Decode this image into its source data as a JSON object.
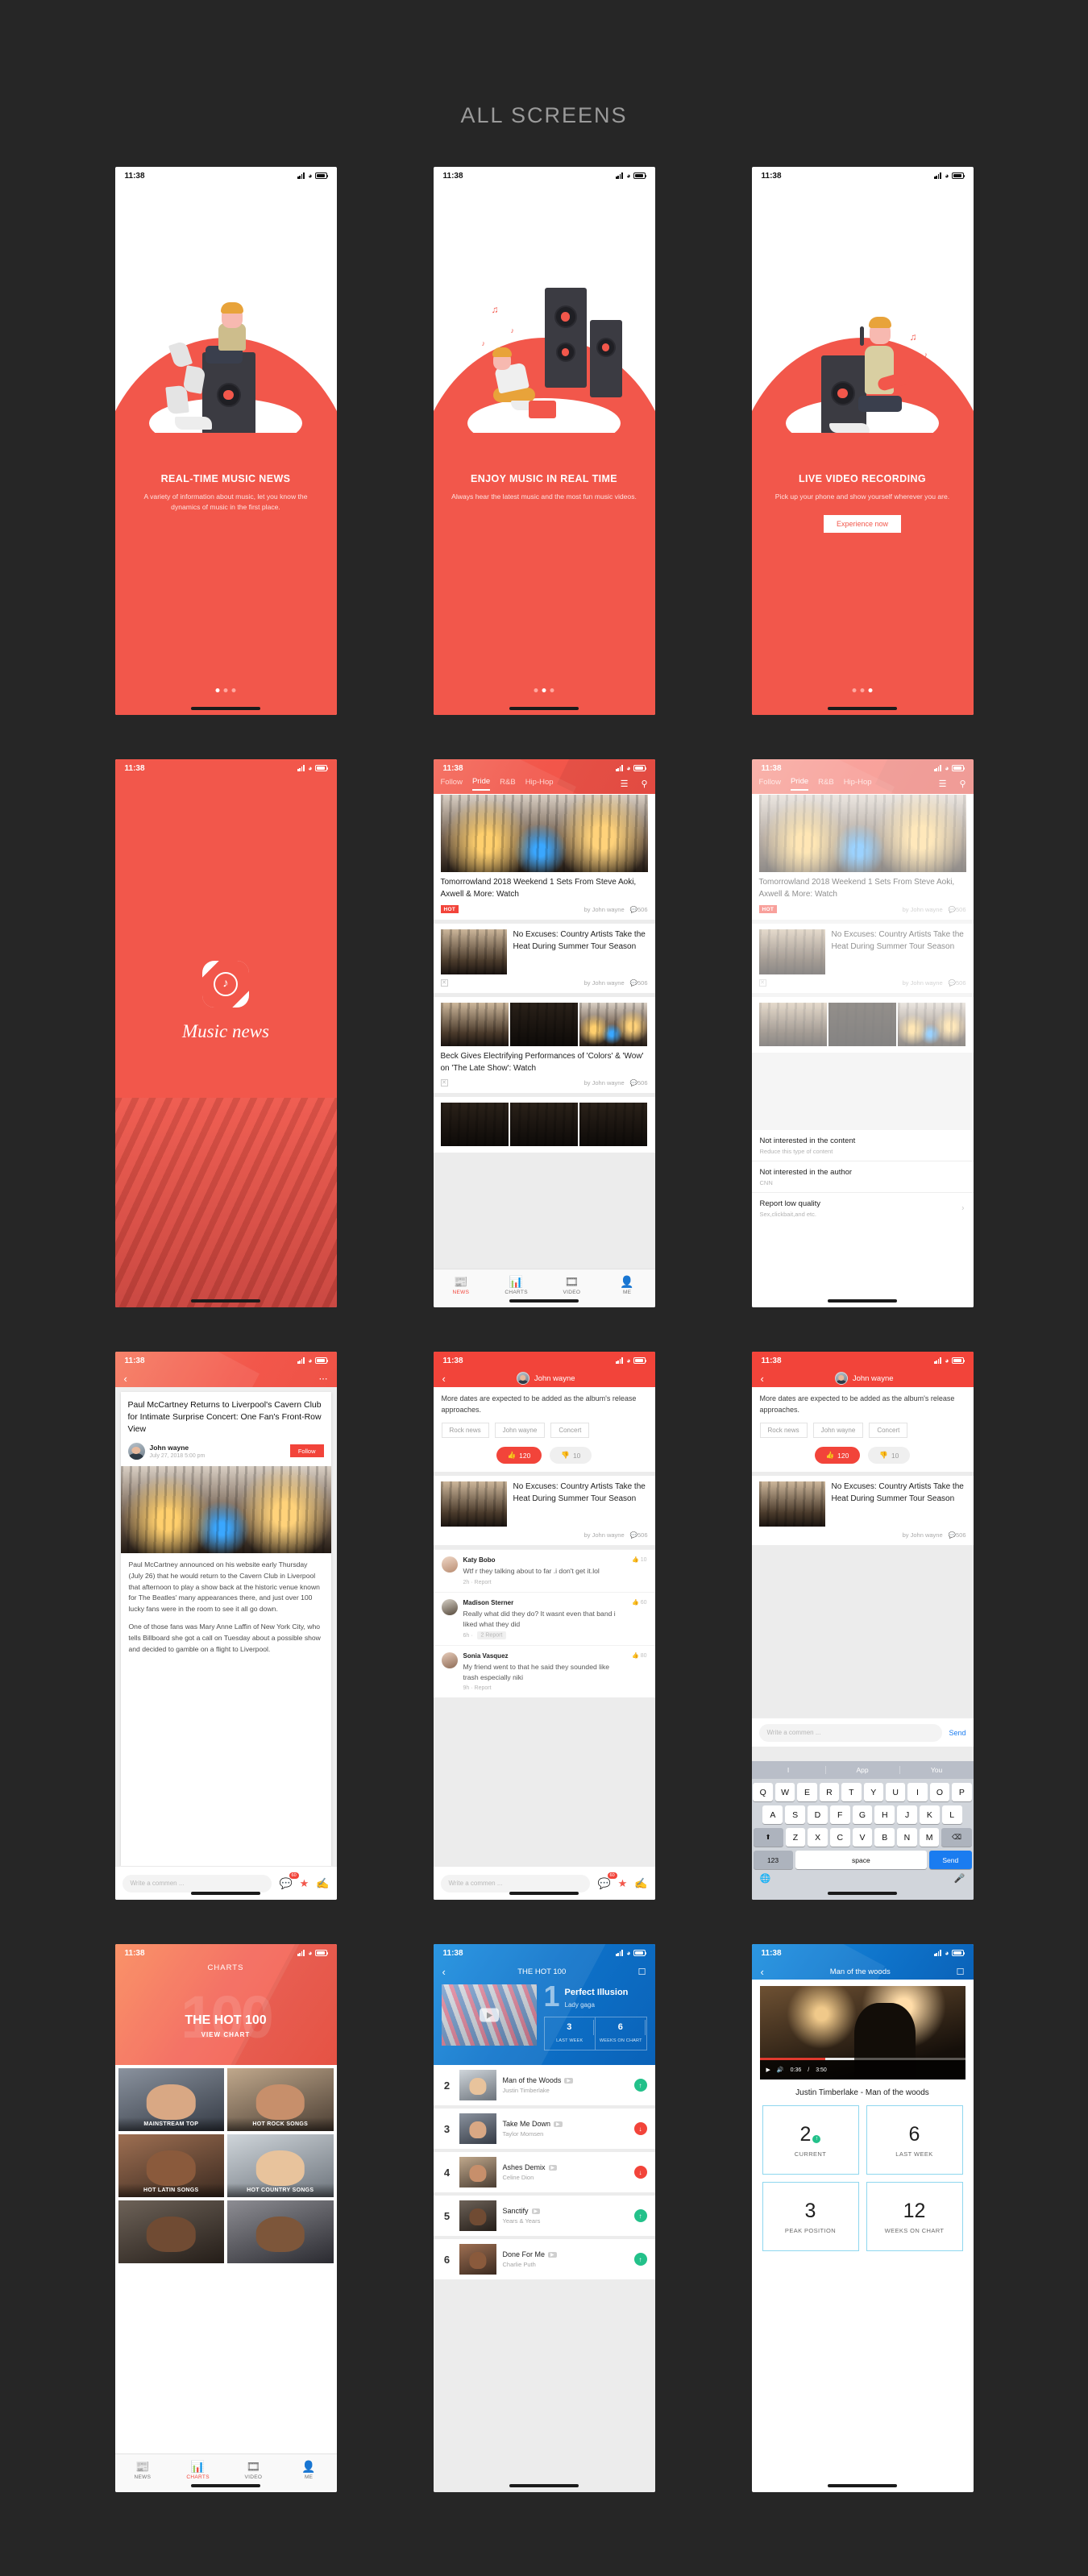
{
  "page": {
    "title": "ALL SCREENS",
    "background": "#262626",
    "accent": "#f2574b",
    "blue": "#0e72c9"
  },
  "status_bar": {
    "time": "11:38",
    "signal_icon": "signal-bars-icon",
    "wifi_icon": "wifi-icon",
    "battery_icon": "battery-icon"
  },
  "onboarding": [
    {
      "title": "REAL-TIME MUSIC NEWS",
      "desc": "A variety of information about music, let you know the dynamics of music in the first place.",
      "active_dot": 0,
      "dots": 3,
      "button": null
    },
    {
      "title": "ENJOY MUSIC IN REAL TIME",
      "desc": "Always hear the latest music and the most fun music videos.",
      "active_dot": 1,
      "dots": 3,
      "button": null
    },
    {
      "title": "LIVE VIDEO RECORDING",
      "desc": "Pick up your phone and show yourself wherever you are.",
      "active_dot": 2,
      "dots": 3,
      "button": "Experience now"
    }
  ],
  "splash": {
    "app_name": "Music news",
    "logo_icon": "music-disc-logo-icon"
  },
  "feed": {
    "tabs": [
      {
        "label": "Follow",
        "active": false
      },
      {
        "label": "Pride",
        "active": true
      },
      {
        "label": "R&B",
        "active": false
      },
      {
        "label": "Hip-Hop",
        "active": false
      }
    ],
    "menu_icon": "hamburger-menu-icon",
    "search_icon": "search-icon",
    "articles": [
      {
        "title": "Tomorrowland 2018 Weekend 1 Sets From Steve Aoki, Axwell & More: Watch",
        "badge": "HOT",
        "author": "by John wayne",
        "comments": "506",
        "layout": "hero"
      },
      {
        "title": "No Excuses: Country Artists Take the Heat During Summer Tour Season",
        "badge": null,
        "author": "by John wayne",
        "comments": "506",
        "layout": "left-thumb"
      },
      {
        "title": "Beck Gives Electrifying Performances of 'Colors' & 'Wow' on 'The Late Show': Watch",
        "badge": null,
        "author": "by John wayne",
        "comments": "506",
        "layout": "three-up"
      }
    ],
    "tabbar": [
      {
        "label": "NEWS",
        "icon": "news-icon",
        "active": true
      },
      {
        "label": "CHARTS",
        "icon": "bar-chart-icon",
        "active": false
      },
      {
        "label": "VIDEO",
        "icon": "film-icon",
        "active": false
      },
      {
        "label": "ME",
        "icon": "person-icon",
        "active": false
      }
    ]
  },
  "action_sheet": [
    {
      "title": "Not interested in the content",
      "sub": "Reduce this type of content",
      "chevron": false
    },
    {
      "title": "Not interested in the author",
      "sub": "CNN",
      "chevron": false
    },
    {
      "title": "Report low quality",
      "sub": "Sex,clickbait,and etc.",
      "chevron": true
    }
  ],
  "article": {
    "back_icon": "chevron-left-icon",
    "more_icon": "more-dots-icon",
    "title": "Paul McCartney Returns to Liverpool's Cavern Club for Intimate Surprise Concert: One Fan's Front-Row View",
    "author": "John wayne",
    "date": "July 27, 2018 5:00 pm",
    "follow_label": "Follow",
    "paragraphs": [
      "Paul McCartney announced on his website early Thursday (July 26) that he would return to the Cavern Club in Liverpool that afternoon to play a show back at the historic venue known for The Beatles' many appearances there, and just over 100 lucky fans were in the room to see it all go down.",
      "One of those fans was Mary Anne Laffin of New York City, who tells Billboard she got a call on Tuesday about a possible show and decided to gamble on a flight to Liverpool."
    ],
    "comment_placeholder": "Write a commen ...",
    "comment_count": "60",
    "icons": {
      "comment": "comment-bubble-icon",
      "star": "star-icon",
      "share": "share-icon"
    }
  },
  "comments_screen": {
    "back_icon": "chevron-left-icon",
    "header_name": "John wayne",
    "intro": "More dates are expected to be added as the album's release approaches.",
    "tags": [
      "Rock news",
      "John wayne",
      "Concert"
    ],
    "likes": "120",
    "dislikes": "10",
    "like_icon": "thumbs-up-icon",
    "dislike_icon": "thumbs-down-icon",
    "related": {
      "title": "No Excuses: Country Artists Take the Heat During Summer Tour Season",
      "author": "by John wayne",
      "comments": "506"
    },
    "comments": [
      {
        "name": "Katy Bobo",
        "text": "Wtf r they talking about to far .i don't get it.lol",
        "time": "2h",
        "action": "Report",
        "likes": "10"
      },
      {
        "name": "Madison Sterner",
        "text": "Really what did they do? It wasnt even that band i liked what they did",
        "time": "6h",
        "action": "2 Report",
        "likes": "60"
      },
      {
        "name": "Sonia Vasquez",
        "text": "My friend went to that he said they sounded like trash especially niki",
        "time": "9h",
        "action": "Report",
        "likes": "80"
      }
    ],
    "comment_placeholder": "Write a commen ...",
    "send_label": "Send"
  },
  "keyboard": {
    "suggestions": [
      "I",
      "App",
      "You"
    ],
    "row1": [
      "Q",
      "W",
      "E",
      "R",
      "T",
      "Y",
      "U",
      "I",
      "O",
      "P"
    ],
    "row2": [
      "A",
      "S",
      "D",
      "F",
      "G",
      "H",
      "J",
      "K",
      "L"
    ],
    "row3": [
      "Z",
      "X",
      "C",
      "V",
      "B",
      "N",
      "M"
    ],
    "shift_icon": "shift-arrow-icon",
    "backspace_icon": "backspace-icon",
    "numbers_label": "123",
    "space_label": "space",
    "send_label": "Send",
    "globe_icon": "globe-icon",
    "mic_icon": "microphone-icon"
  },
  "charts": {
    "header": "CHARTS",
    "ghost": "100",
    "title": "THE HOT 100",
    "view_chart": "VIEW CHART",
    "cells": [
      "MAINSTREAM TOP",
      "HOT ROCK SONGS",
      "HOT LATIN SONGS",
      "HOT COUNTRY SONGS",
      "",
      ""
    ]
  },
  "hot100": {
    "back_icon": "chevron-left-icon",
    "title": "THE HOT 100",
    "share_icon": "share-box-icon",
    "play_icon": "play-icon",
    "featured": {
      "rank": "1",
      "song": "Perfect Illusion",
      "artist": "Lady gaga",
      "stats": [
        {
          "value": "3",
          "label": "LAST WEEK"
        },
        {
          "value": "6",
          "label": "WEEKS ON CHART"
        }
      ]
    },
    "list": [
      {
        "rank": "2",
        "song": "Man of the Woods",
        "artist": "Justin Timberlake",
        "badge": "yt",
        "trend": "up"
      },
      {
        "rank": "3",
        "song": "Take Me Down",
        "artist": "Taylor Momsen",
        "badge": "yt",
        "trend": "down"
      },
      {
        "rank": "4",
        "song": "Ashes  Demix",
        "artist": "Celine Dion",
        "badge": "yt",
        "trend": "down"
      },
      {
        "rank": "5",
        "song": "Sanctify",
        "artist": "Years & Years",
        "badge": "yt",
        "trend": "up"
      },
      {
        "rank": "6",
        "song": "Done For Me",
        "artist": "Charlie Puth",
        "badge": "yt",
        "trend": "up"
      }
    ]
  },
  "song_detail": {
    "back_icon": "chevron-left-icon",
    "title": "Man of the woods",
    "share_icon": "share-box-icon",
    "player": {
      "play_icon": "play-icon",
      "volume_icon": "volume-icon",
      "current_time": "0:36",
      "separator": "/",
      "duration": "3:50"
    },
    "song_title": "Justin Timberlake - Man of the woods",
    "stats": [
      {
        "value": "2",
        "label": "CURRENT",
        "trend": "up"
      },
      {
        "value": "6",
        "label": "LAST WEEK",
        "trend": null
      },
      {
        "value": "3",
        "label": "PEAK POSITION",
        "trend": null
      },
      {
        "value": "12",
        "label": "WEEKS ON CHART",
        "trend": null
      }
    ]
  }
}
